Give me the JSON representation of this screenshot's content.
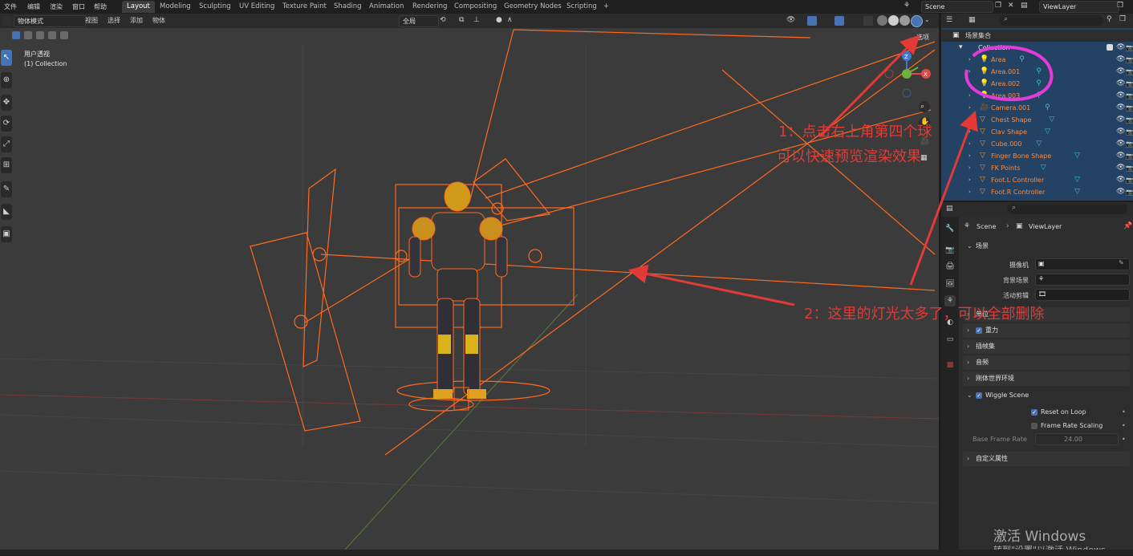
{
  "menu": {
    "items": [
      "文件",
      "编辑",
      "渲染",
      "窗口",
      "帮助"
    ]
  },
  "workspaces": {
    "tabs": [
      "Layout",
      "Modeling",
      "Sculpting",
      "UV Editing",
      "Texture Paint",
      "Shading",
      "Animation",
      "Rendering",
      "Compositing",
      "Geometry Nodes",
      "Scripting"
    ],
    "add": "+"
  },
  "scene_selector": {
    "value": "Scene"
  },
  "viewlayer_selector": {
    "value": "ViewLayer"
  },
  "viewport": {
    "mode": "物体模式",
    "menus": [
      "视图",
      "选择",
      "添加",
      "物体"
    ],
    "orientation": "全局",
    "options_label": "选项",
    "overlay_title": "用户透视",
    "overlay_subtitle": "(1) Collection",
    "gizmo": {
      "z": "Z",
      "y": "Y",
      "x": "X"
    }
  },
  "outliner": {
    "root": "场景集合",
    "collection": "Collection",
    "rows": [
      "Area",
      "Area.001",
      "Area.002",
      "Area.003",
      "Camera.001",
      "Chest Shape",
      "Clav Shape",
      "Cube.000",
      "Finger Bone Shape",
      "FK Points",
      "Foot.L Controller",
      "Foot.R Controller"
    ]
  },
  "properties": {
    "breadcrumb_scene": "Scene",
    "breadcrumb_layer": "ViewLayer",
    "section_scene": "场景",
    "camera_label": "摄像机",
    "bg_scene_label": "背景场景",
    "active_clip_label": "活动剪辑",
    "panels": {
      "units": "单位",
      "gravity": "重力",
      "keying": "插帧集",
      "audio": "音频",
      "rigid": "刚体世界环境",
      "wiggle": "Wiggle Scene",
      "custom": "自定义属性"
    },
    "reset_on_loop": "Reset on Loop",
    "frame_rate_scaling": "Frame Rate Scaling",
    "base_frame_rate_label": "Base Frame Rate",
    "base_frame_rate_value": "24.00"
  },
  "annotations": {
    "note1_line1": "1：点击右上角第四个球",
    "note1_line2": "可以快速预览渲染效果",
    "note2": "2：这里的灯光太多了，可以全部删除"
  },
  "watermark": {
    "line1": "激活 Windows",
    "line2": "转到\"设置\"以激活 Windows。"
  },
  "colors": {
    "accent": "#4772b3",
    "annotation": "#e23a36",
    "light_wire": "#ff6a1f",
    "highlight_circle": "#e63ad8",
    "outliner_select": "#234264"
  }
}
